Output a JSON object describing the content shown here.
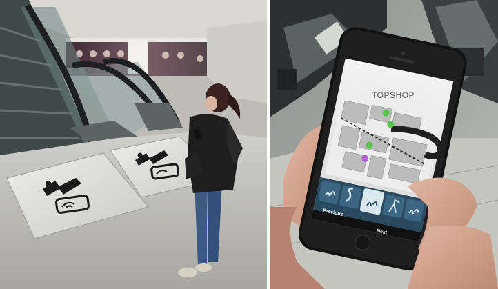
{
  "photo_left": {
    "subject": "woman-using-phone-at-escalator",
    "floor_markers": [
      "escalator-nfc-marker",
      "escalator-nfc-marker"
    ]
  },
  "photo_right": {
    "store_sign": "TOPSHOP",
    "nav_buttons": {
      "previous": "Previous",
      "next": "Next"
    },
    "steps": [
      {
        "icon": "footsteps-icon",
        "caption": ""
      },
      {
        "icon": "turn-icon",
        "caption": ""
      },
      {
        "icon": "footsteps-icon",
        "caption": ""
      },
      {
        "icon": "split-arrow-icon",
        "caption": ""
      },
      {
        "icon": "footsteps-icon",
        "caption": ""
      }
    ]
  },
  "colors": {
    "map_green": "#55c24a",
    "map_purple": "#b45ad6",
    "nav_bar_blue": "#2a4a60",
    "selected_step": "#d9e7ef"
  }
}
